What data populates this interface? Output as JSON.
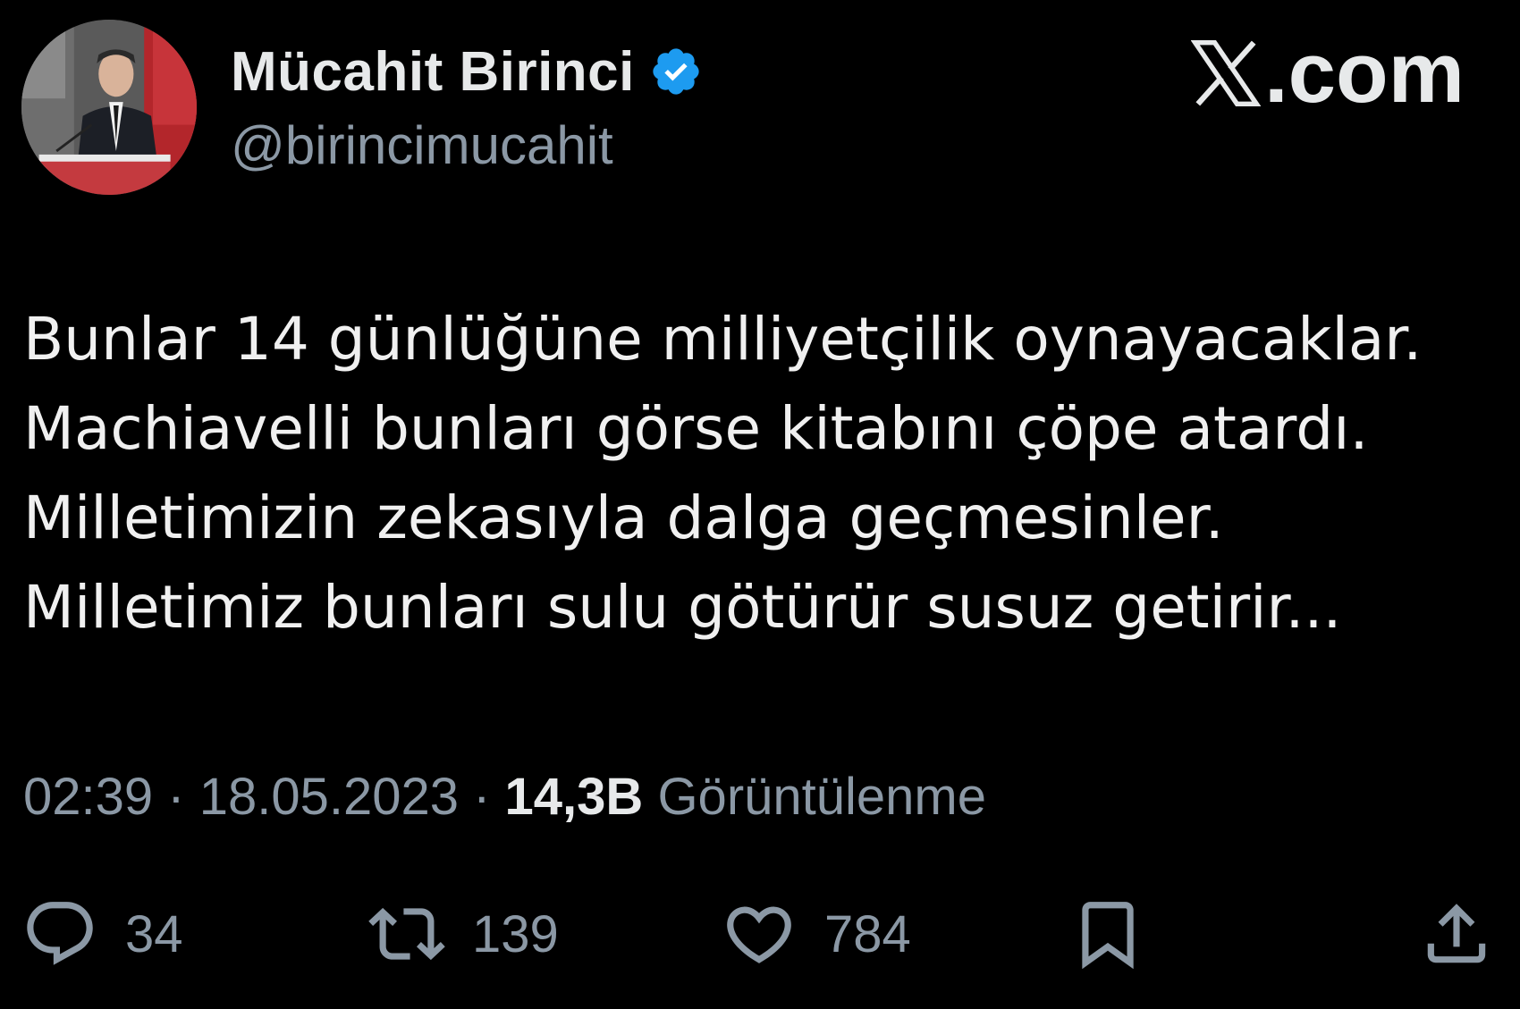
{
  "author": {
    "display_name": "Mücahit Birinci",
    "handle": "@birincimucahit",
    "verified": true,
    "verified_color": "#1d9bf0"
  },
  "brand": {
    "label": ".com"
  },
  "tweet": {
    "lines": [
      "Bunlar 14 günlüğüne milliyetçilik oynayacaklar.",
      "Machiavelli bunları görse kitabını çöpe atardı.",
      "Milletimizin zekasıyla dalga geçmesinler.",
      "Milletimiz bunları sulu götürür susuz getirir..."
    ]
  },
  "meta": {
    "time": "02:39",
    "separator": " · ",
    "date": "18.05.2023",
    "views_count": "14,3B",
    "views_label": " Görüntülenme"
  },
  "actions": {
    "reply_count": "34",
    "retweet_count": "139",
    "like_count": "784"
  },
  "icons": {
    "reply": "reply-icon",
    "retweet": "retweet-icon",
    "like": "heart-icon",
    "bookmark": "bookmark-icon",
    "share": "share-icon",
    "verified": "verified-badge-icon",
    "brand": "x-logo-icon"
  }
}
